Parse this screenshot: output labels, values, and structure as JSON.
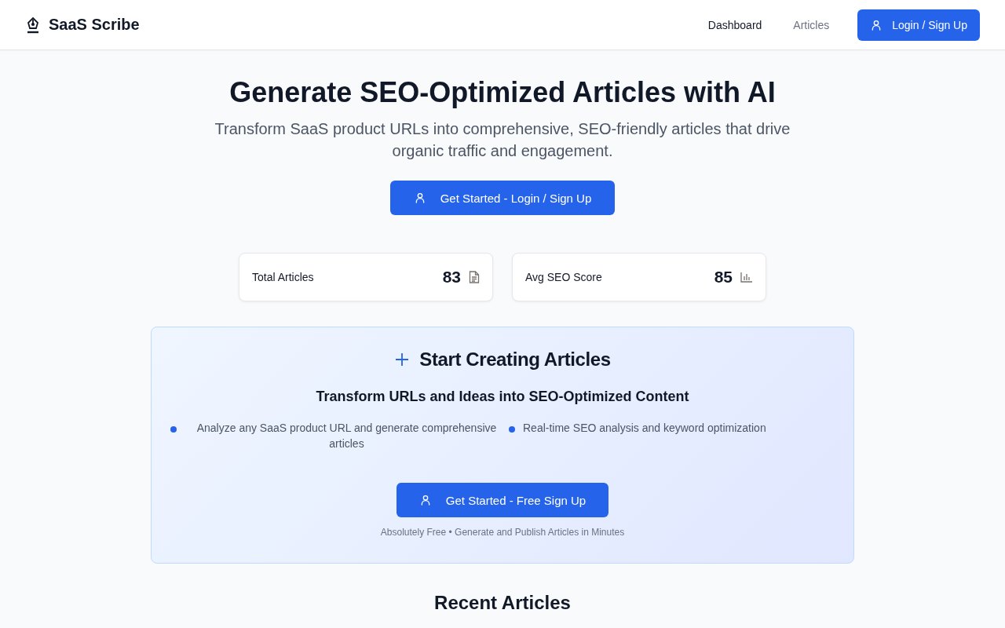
{
  "header": {
    "brand": "SaaS Scribe",
    "nav": [
      {
        "label": "Dashboard",
        "selected": true
      },
      {
        "label": "Articles",
        "selected": false
      }
    ],
    "login_button": "Login / Sign Up"
  },
  "hero": {
    "title": "Generate SEO-Optimized Articles with AI",
    "subtitle": "Transform SaaS product URLs into comprehensive, SEO-friendly articles that drive organic traffic and engagement.",
    "button": "Get Started - Login / Sign Up"
  },
  "stats": [
    {
      "label": "Total Articles",
      "value": "83",
      "kind": "document"
    },
    {
      "label": "Avg SEO Score",
      "value": "85",
      "kind": "chart"
    }
  ],
  "create_panel": {
    "title": "Start Creating Articles",
    "subtitle": "Transform URLs and Ideas into SEO-Optimized Content",
    "features": [
      "Analyze any SaaS product URL and generate comprehensive articles",
      "Real-time SEO analysis and keyword optimization"
    ],
    "button": "Get Started - Free Sign Up",
    "note": "Absolutely Free • Generate and Publish Articles in Minutes"
  },
  "recent": {
    "title": "Recent Articles"
  }
}
